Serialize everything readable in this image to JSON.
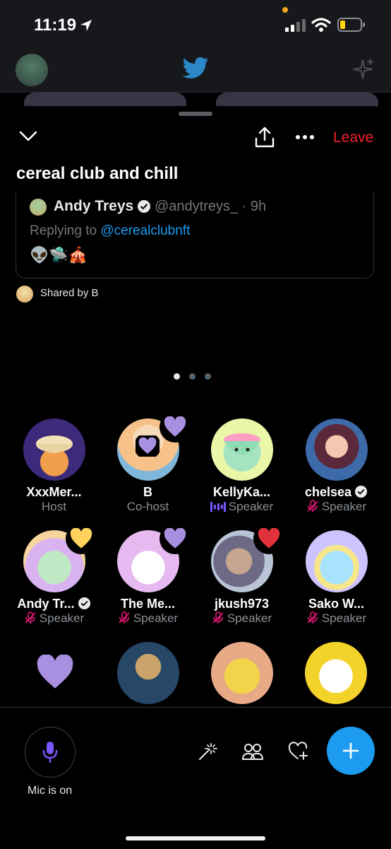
{
  "status": {
    "time": "11:19"
  },
  "space": {
    "title": "cereal club and chill",
    "leave_label": "Leave",
    "shared_by": "Shared by B"
  },
  "tweet": {
    "name": "Andy Treys",
    "handle_time": "@andytreys_ · 9h",
    "replying_prefix": "Replying to ",
    "replying_handle": "@cerealclubnft",
    "emojis": "👽🛸🎪"
  },
  "pager": {
    "count": 3,
    "active": 0
  },
  "participants": [
    {
      "name": "XxxMer...",
      "role": "Host",
      "status": "none",
      "verified": false
    },
    {
      "name": "B",
      "role": "Co-host",
      "status": "none",
      "verified": false,
      "reaction": "purple-heart"
    },
    {
      "name": "KellyKa...",
      "role": "Speaker",
      "status": "speaking",
      "verified": false
    },
    {
      "name": "chelsea",
      "role": "Speaker",
      "status": "muted",
      "verified": true
    },
    {
      "name": "Andy Tr...",
      "role": "Speaker",
      "status": "muted",
      "verified": true,
      "reaction": "yellow-heart"
    },
    {
      "name": "The Me...",
      "role": "Speaker",
      "status": "muted",
      "verified": false,
      "reaction": "purple-heart"
    },
    {
      "name": "jkush973",
      "role": "Speaker",
      "status": "muted",
      "verified": false,
      "reaction": "red-heart"
    },
    {
      "name": "Sako W...",
      "role": "Speaker",
      "status": "muted",
      "verified": false
    }
  ],
  "bottom": {
    "mic_label": "Mic is on"
  },
  "colors": {
    "accent": "#1d9bf0",
    "leave": "#f4212e",
    "muted": "#f91880",
    "speaking": "#7856ff",
    "purple_heart": "#a98fe0",
    "yellow_heart": "#ffd35c",
    "red_heart": "#e0323e"
  }
}
